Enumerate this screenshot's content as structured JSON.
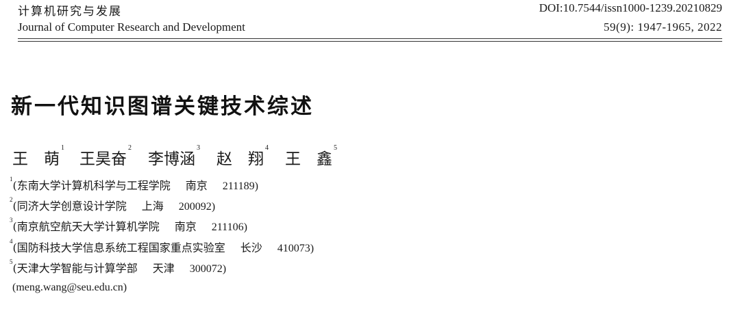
{
  "header": {
    "journal_cn": "计算机研究与发展",
    "journal_en": "Journal of Computer Research and Development",
    "doi": "DOI:10.7544/issn1000-1239.20210829",
    "volume": "59(9): 1947-1965, 2022"
  },
  "title": "新一代知识图谱关键技术综述",
  "authors": [
    {
      "name": "王　萌",
      "sup": "1"
    },
    {
      "name": "王昊奋",
      "sup": "2"
    },
    {
      "name": "李博涵",
      "sup": "3"
    },
    {
      "name": "赵　翔",
      "sup": "4"
    },
    {
      "name": "王　鑫",
      "sup": "5"
    }
  ],
  "affiliations": [
    {
      "sup": "1",
      "org": "(东南大学计算机科学与工程学院",
      "city": "南京",
      "zip": "211189)"
    },
    {
      "sup": "2",
      "org": "(同济大学创意设计学院",
      "city": "上海",
      "zip": "200092)"
    },
    {
      "sup": "3",
      "org": "(南京航空航天大学计算机学院",
      "city": "南京",
      "zip": "211106)"
    },
    {
      "sup": "4",
      "org": "(国防科技大学信息系统工程国家重点实验室",
      "city": "长沙",
      "zip": "410073)"
    },
    {
      "sup": "5",
      "org": "(天津大学智能与计算学部",
      "city": "天津",
      "zip": "300072)"
    }
  ],
  "email": "(meng.wang@seu.edu.cn)"
}
